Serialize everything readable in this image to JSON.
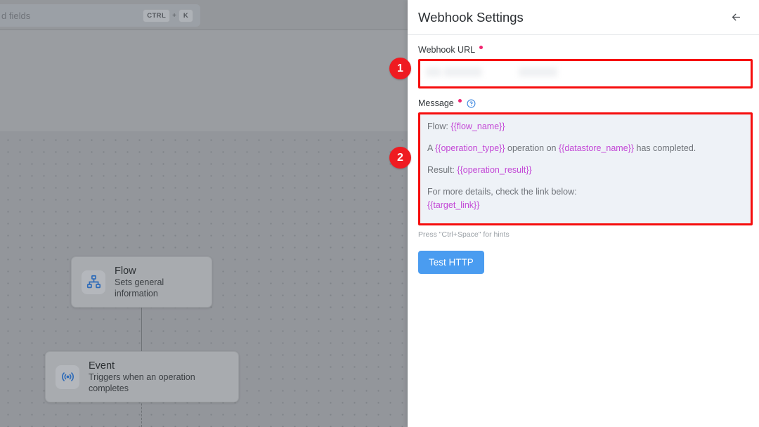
{
  "canvas": {
    "search": {
      "text": "d fields",
      "placeholder": "Search fields",
      "shortcut_key1": "CTRL",
      "shortcut_plus": "+",
      "shortcut_key2": "K"
    },
    "nodes": [
      {
        "id": "flow",
        "title": "Flow",
        "subtitle": "Sets general information",
        "icon": "sitemap-icon"
      },
      {
        "id": "event",
        "title": "Event",
        "subtitle": "Triggers when an operation completes",
        "icon": "broadcast-icon"
      }
    ]
  },
  "panel": {
    "title": "Webhook Settings",
    "back_icon": "arrow-left-icon",
    "fields": {
      "webhook_url": {
        "label": "Webhook URL",
        "required": true,
        "value": "",
        "placeholder": ""
      },
      "message": {
        "label": "Message",
        "required": true,
        "help_icon": "question-circle-icon",
        "lines": [
          {
            "prefix": "Flow: ",
            "variable": "{{flow_name}}",
            "suffix": ""
          },
          {
            "prefix": "A ",
            "variable": "{{operation_type}}",
            "middle": " operation on ",
            "variable2": "{{datastore_name}}",
            "suffix": " has completed."
          },
          {
            "prefix": "Result: ",
            "variable": "{{operation_result}}",
            "suffix": ""
          },
          {
            "prefix": "For more details, check the link below:",
            "variable": "",
            "suffix": ""
          },
          {
            "prefix": "",
            "variable": "{{target_link}}",
            "suffix": ""
          }
        ]
      }
    },
    "hint": "Press \"Ctrl+Space\" for hints",
    "test_button": "Test HTTP"
  },
  "annotations": [
    {
      "number": "1",
      "target": "webhook-url-field"
    },
    {
      "number": "2",
      "target": "message-field"
    }
  ],
  "colors": {
    "accent_blue": "#4a9cf0",
    "required_pink": "#f0256f",
    "annotation_red": "#ef1b21",
    "highlight_red": "#f60d0d",
    "variable_purple": "#c348d6"
  }
}
